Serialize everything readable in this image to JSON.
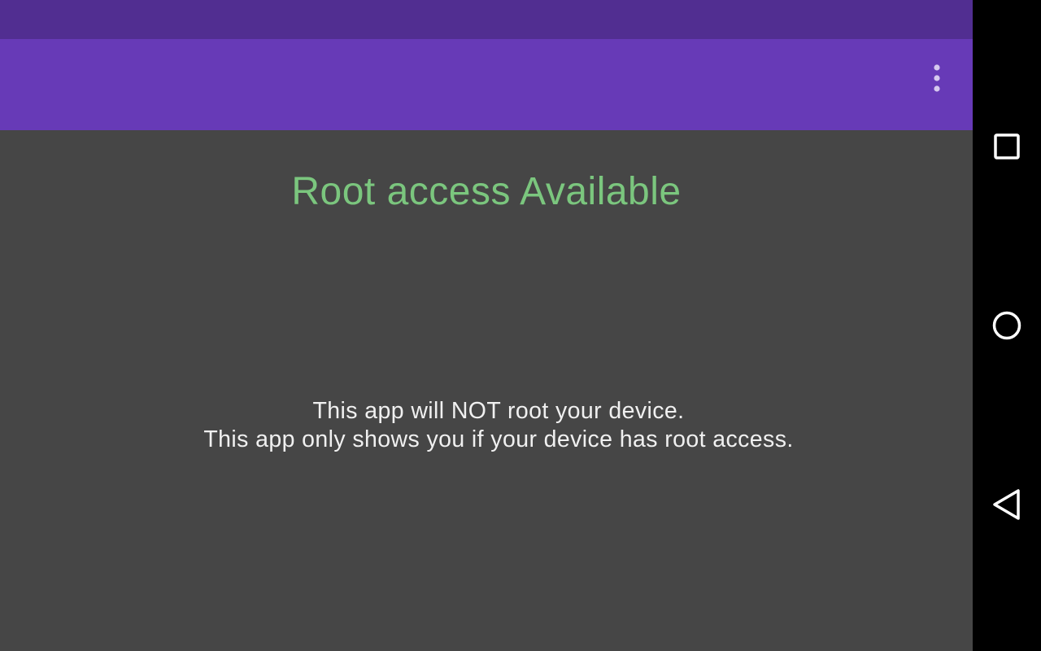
{
  "status_bar": {
    "color": "#512e91"
  },
  "toolbar": {
    "color": "#673ab7",
    "overflow_icon": "more-vert-icon"
  },
  "content": {
    "root_status": "Root access Available",
    "root_status_color": "#7bc67e",
    "disclaimer_line_1": "This app will NOT root your device.",
    "disclaimer_line_2": "This app only shows you if your device has root access."
  },
  "nav_bar": {
    "buttons": [
      {
        "name": "recents",
        "icon": "square-icon"
      },
      {
        "name": "home",
        "icon": "circle-icon"
      },
      {
        "name": "back",
        "icon": "triangle-back-icon"
      }
    ]
  }
}
